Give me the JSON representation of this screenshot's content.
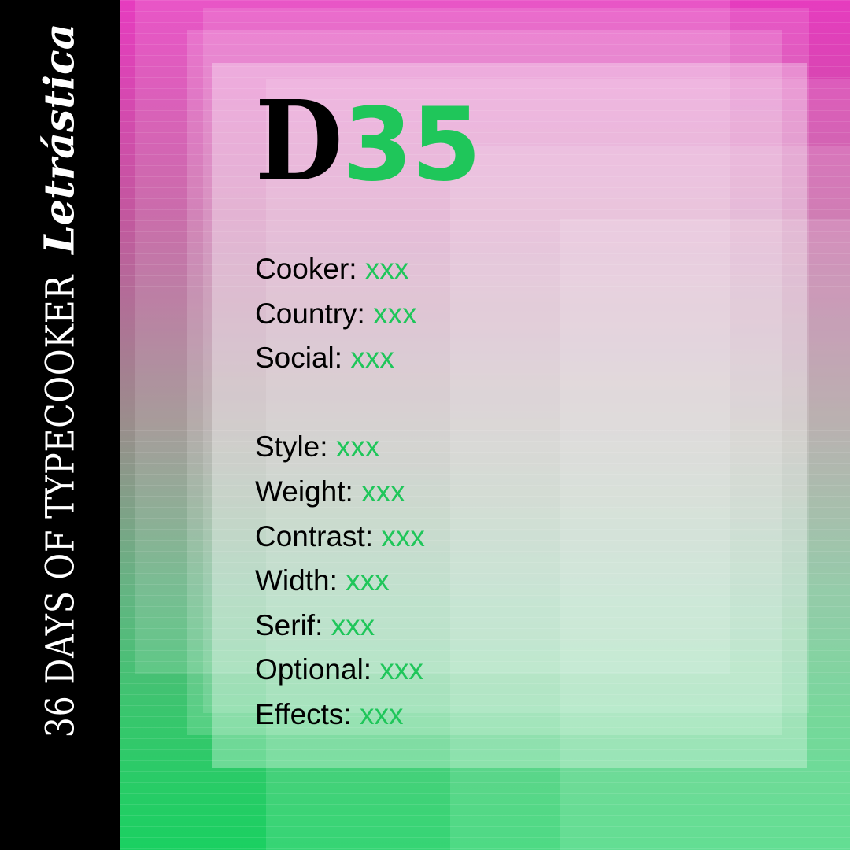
{
  "sidebar": {
    "title": "36 DAYS OF TYPECOOKER",
    "brand": "Letrástica"
  },
  "header": {
    "letter": "D",
    "number": "35"
  },
  "cooker_info": [
    {
      "label": "Cooker:",
      "value": "xxx"
    },
    {
      "label": "Country:",
      "value": "xxx"
    },
    {
      "label": "Social:",
      "value": "xxx"
    }
  ],
  "recipe": [
    {
      "label": "Style:",
      "value": "xxx"
    },
    {
      "label": "Weight:",
      "value": "xxx"
    },
    {
      "label": "Contrast:",
      "value": "xxx"
    },
    {
      "label": "Width:",
      "value": "xxx"
    },
    {
      "label": "Serif:",
      "value": "xxx"
    },
    {
      "label": "Optional:",
      "value": "xxx"
    },
    {
      "label": "Effects:",
      "value": "xxx"
    }
  ],
  "colors": {
    "accent_green": "#1fc65a",
    "magenta": "#e63cbf",
    "band": "#000000"
  }
}
